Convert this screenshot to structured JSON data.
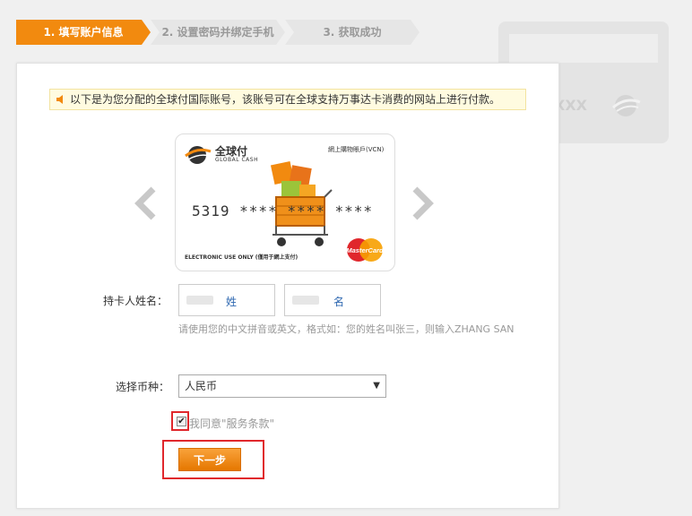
{
  "steps": [
    {
      "label": "1. 填写账户信息"
    },
    {
      "label": "2. 设置密码并绑定手机"
    },
    {
      "label": "3. 获取成功"
    }
  ],
  "notice": {
    "text": "以下是为您分配的全球付国际账号，该账号可在全球支持万事达卡消费的网站上进行付款。"
  },
  "card": {
    "brand": "全球付",
    "brand_sub": "GLOBAL CASH",
    "vcn_label": "網上購物賬戶(VCN)",
    "number": "5319 **** **** ****",
    "electronic_use": "ELECTRONIC USE ONLY (僅用于網上支付)",
    "mastercard": "MasterCard"
  },
  "bg_card": {
    "masked": "XXX"
  },
  "form": {
    "name_label": "持卡人姓名：",
    "surname_hint": "姓",
    "givenname_hint": "名",
    "help_text": "请使用您的中文拼音或英文，格式如：您的姓名叫张三，则输入ZHANG SAN",
    "currency_label": "选择币种：",
    "currency_value": "人民币",
    "agree_text": "我同意\"服务条款\"",
    "next_button": "下一步"
  },
  "colors": {
    "accent": "#f28a0f",
    "highlight": "#e0272c",
    "link": "#2d67b0"
  }
}
